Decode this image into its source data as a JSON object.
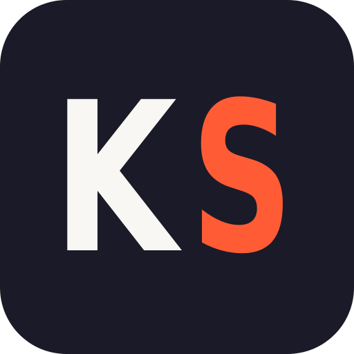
{
  "icon": {
    "letter_primary": "K",
    "letter_accent": "S",
    "background_color": "#1b1a28",
    "primary_color": "#f8f7f3",
    "accent_color": "#ff5c35"
  }
}
